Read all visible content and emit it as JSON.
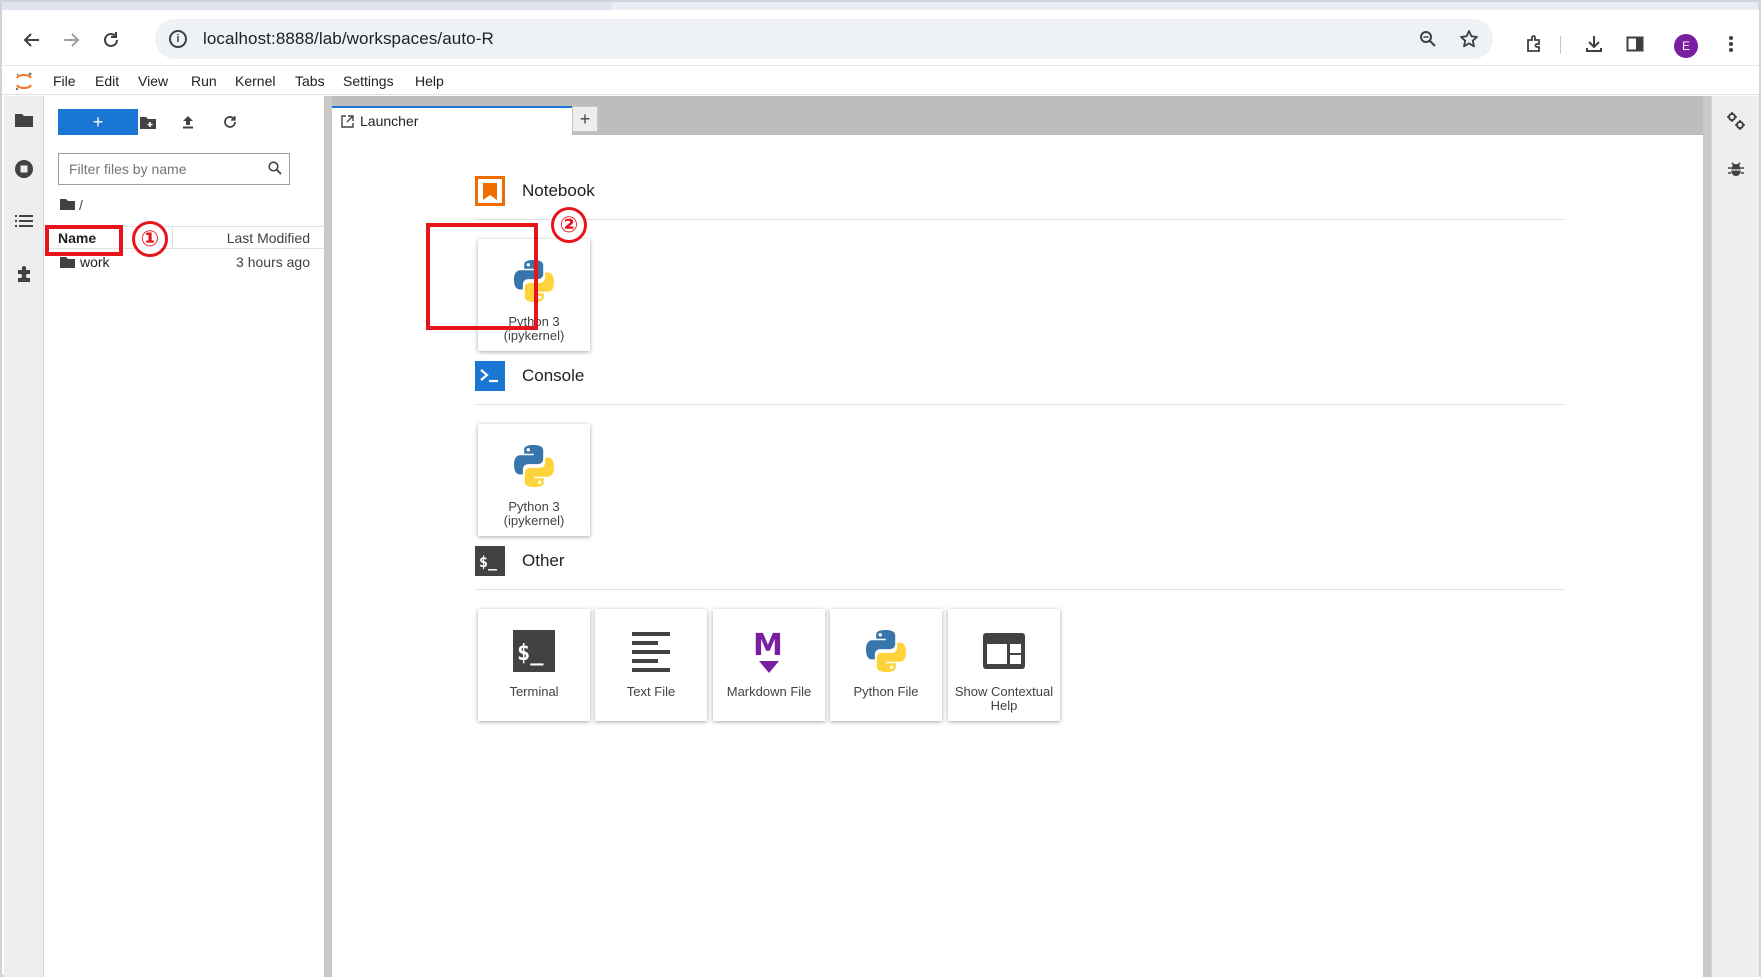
{
  "browser": {
    "url": "localhost:8888/lab/workspaces/auto-R",
    "profile_initial": "E",
    "profile_color": "#7b1fa2"
  },
  "menu": {
    "items": [
      "File",
      "Edit",
      "View",
      "Run",
      "Kernel",
      "Tabs",
      "Settings",
      "Help"
    ]
  },
  "filebrowser": {
    "new_label": "+",
    "filter_placeholder": "Filter files by name",
    "breadcrumb": "/",
    "col_name": "Name",
    "col_modified": "Last Modified",
    "files": [
      {
        "name": "work",
        "type": "folder",
        "modified": "3 hours ago"
      }
    ]
  },
  "dock": {
    "tabs": [
      {
        "label": "Launcher",
        "active": true
      }
    ],
    "add_tab_label": "+"
  },
  "launcher": {
    "sections": [
      {
        "title": "Notebook",
        "icon": "notebook-icon",
        "cards": [
          {
            "label": "Python 3\n(ipykernel)",
            "icon": "python-icon"
          }
        ]
      },
      {
        "title": "Console",
        "icon": "console-icon",
        "cards": [
          {
            "label": "Python 3\n(ipykernel)",
            "icon": "python-icon"
          }
        ]
      },
      {
        "title": "Other",
        "icon": "terminal-section-icon",
        "cards": [
          {
            "label": "Terminal",
            "icon": "terminal-icon"
          },
          {
            "label": "Text File",
            "icon": "text-file-icon"
          },
          {
            "label": "Markdown File",
            "icon": "markdown-icon"
          },
          {
            "label": "Python File",
            "icon": "python-icon"
          },
          {
            "label": "Show Contextual Help",
            "icon": "contextual-help-icon"
          }
        ]
      }
    ]
  },
  "annotations": {
    "step1": "①",
    "step2": "②",
    "color": "#e8141b"
  },
  "colors": {
    "accent": "#1976d2",
    "notebook_orange": "#ef6c00",
    "console_blue": "#1976d2",
    "markdown_purple": "#7b1fa2"
  }
}
